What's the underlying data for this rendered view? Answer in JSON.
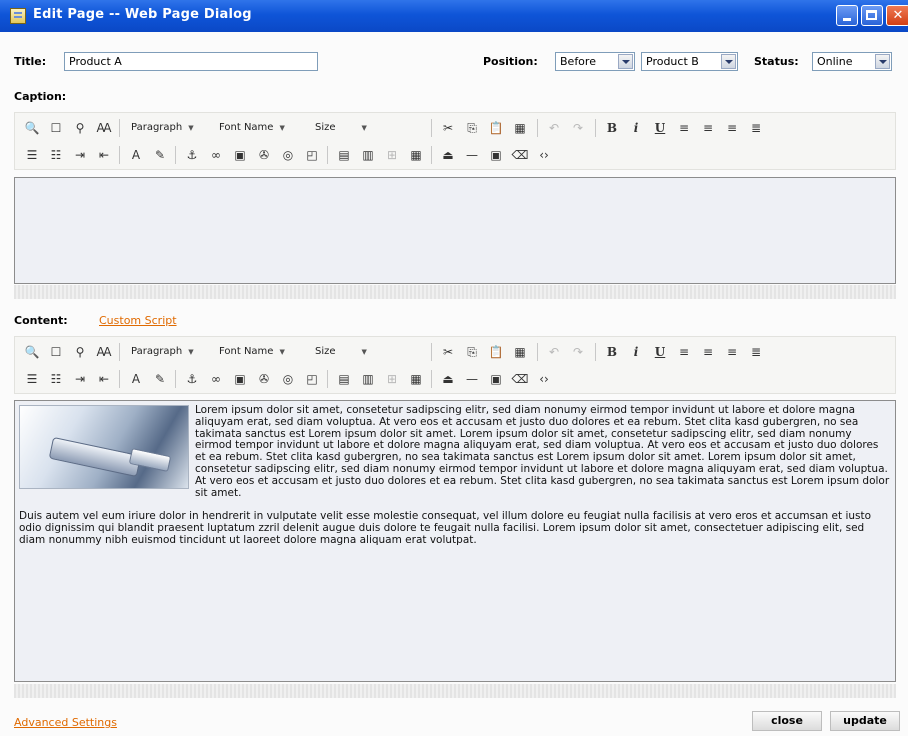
{
  "window": {
    "title": "Edit Page -- Web Page Dialog"
  },
  "form": {
    "title_label": "Title:",
    "title_value": "Product A",
    "position_label": "Position:",
    "position_value": "Before",
    "position_target": "Product B",
    "status_label": "Status:",
    "status_value": "Online",
    "caption_label": "Caption:",
    "content_label": "Content:",
    "custom_script_link": "Custom Script"
  },
  "toolbar": {
    "paragraph": "Paragraph",
    "font_name": "Font Name",
    "size": "Size",
    "bold": "B",
    "italic": "i",
    "underline": "U"
  },
  "content": {
    "paragraph1": "Lorem ipsum dolor sit amet, consetetur sadipscing elitr,  sed diam nonumy eirmod tempor invidunt ut labore et dolore magna aliquyam erat, sed diam voluptua. At vero eos et accusam et justo duo dolores et ea rebum. Stet clita kasd gubergren, no sea takimata sanctus est Lorem ipsum dolor sit amet. Lorem ipsum dolor sit amet, consetetur sadipscing elitr,  sed diam nonumy eirmod tempor invidunt ut labore et dolore magna aliquyam erat, sed diam voluptua. At vero eos et accusam et justo duo dolores et ea rebum. Stet clita kasd gubergren, no sea takimata sanctus est Lorem ipsum dolor sit amet. Lorem ipsum dolor sit amet, consetetur sadipscing elitr,  sed diam nonumy eirmod tempor invidunt ut labore et dolore magna aliquyam erat, sed diam voluptua. At vero eos et accusam et justo duo dolores et ea rebum. Stet clita kasd gubergren, no sea takimata sanctus est Lorem ipsum dolor sit amet.",
    "paragraph2": "Duis autem vel eum iriure dolor in hendrerit in vulputate velit esse molestie consequat, vel illum dolore eu feugiat nulla facilisis at vero eros et accumsan et iusto odio dignissim qui blandit praesent luptatum zzril delenit augue duis dolore te feugait nulla facilisi. Lorem ipsum dolor sit amet, consectetuer adipiscing elit, sed diam nonummy nibh euismod tincidunt ut laoreet dolore magna aliquam erat volutpat."
  },
  "footer": {
    "advanced_settings_link": "Advanced Settings",
    "close_button": "close",
    "update_button": "update"
  },
  "colors": {
    "titlebar": "#0f55d8",
    "link": "#e06a00",
    "editor_bg": "#eef0f5"
  }
}
